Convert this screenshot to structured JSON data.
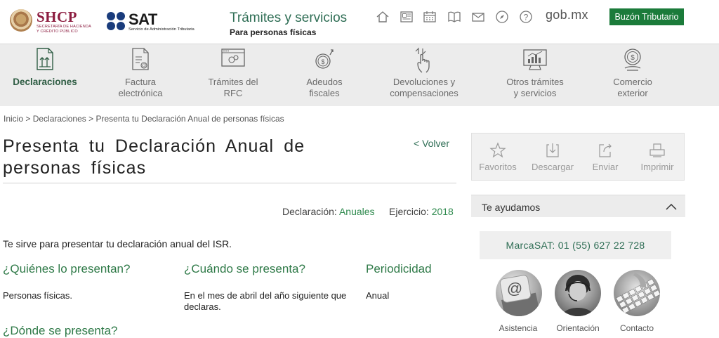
{
  "header": {
    "shcp": {
      "title": "SHCP",
      "subtitle_line1": "SECRETARÍA DE HACIENDA",
      "subtitle_line2": "Y CRÉDITO PÚBLICO"
    },
    "sat": {
      "title": "SAT",
      "subtitle": "Servicio de Administración Tributaria"
    },
    "section_title": "Trámites y servicios",
    "section_subtitle": "Para personas físicas",
    "icons": [
      "home-icon",
      "news-icon",
      "calendar-icon",
      "book-icon",
      "mail-icon",
      "compass-icon",
      "help-icon"
    ],
    "gob_label": "gob.mx",
    "buzon_label": "Buzón Tributario"
  },
  "nav": {
    "items": [
      {
        "label": "Declaraciones",
        "icon": "declaraciones-icon",
        "active": true
      },
      {
        "label": "Factura\nelectrónica",
        "icon": "factura-icon",
        "active": false
      },
      {
        "label": "Trámites del\nRFC",
        "icon": "rfc-icon",
        "active": false
      },
      {
        "label": "Adeudos\nfiscales",
        "icon": "adeudos-icon",
        "active": false
      },
      {
        "label": "Devoluciones y\ncompensaciones",
        "icon": "devoluciones-icon",
        "active": false
      },
      {
        "label": "Otros trámites\ny servicios",
        "icon": "otros-tramites-icon",
        "active": false
      },
      {
        "label": "Comercio\nexterior",
        "icon": "comercio-icon",
        "active": false
      }
    ]
  },
  "breadcrumb": {
    "items": [
      "Inicio",
      "Declaraciones",
      "Presenta tu Declaración Anual de personas físicas"
    ],
    "separator": ">"
  },
  "page": {
    "title": "Presenta tu Declaración Anual de personas físicas",
    "back_link": "< Volver",
    "declaracion_label": "Declaración:",
    "declaracion_value": "Anuales",
    "ejercicio_label": "Ejercicio:",
    "ejercicio_value": "2018",
    "description": "Te sirve para presentar tu declaración anual del ISR.",
    "columns": [
      {
        "heading": "¿Quiénes lo presentan?",
        "text": "Personas físicas."
      },
      {
        "heading": "¿Cuándo se presenta?",
        "text": "En el mes de abril del año siguiente que declaras."
      },
      {
        "heading": "Periodicidad",
        "text": "Anual"
      }
    ],
    "clipped_heading": "¿Dónde se presenta?"
  },
  "sidebar": {
    "actions": [
      {
        "label": "Favoritos",
        "icon": "star-icon"
      },
      {
        "label": "Descargar",
        "icon": "download-icon"
      },
      {
        "label": "Enviar",
        "icon": "share-icon"
      },
      {
        "label": "Imprimir",
        "icon": "print-icon"
      }
    ],
    "help": {
      "title": "Te ayudamos"
    },
    "phone": "MarcaSAT: 01 (55) 627 22 728",
    "contacts": [
      {
        "label": "Asistencia",
        "icon": "email-key-icon"
      },
      {
        "label": "Orientación",
        "icon": "headset-icon"
      },
      {
        "label": "Contacto",
        "icon": "keyboard-icon"
      }
    ]
  },
  "colors": {
    "brand_green": "#2f6e55",
    "button_green": "#1b7b3a",
    "shcp_red": "#8c1d40",
    "sat_blue": "#1a3c7c"
  }
}
